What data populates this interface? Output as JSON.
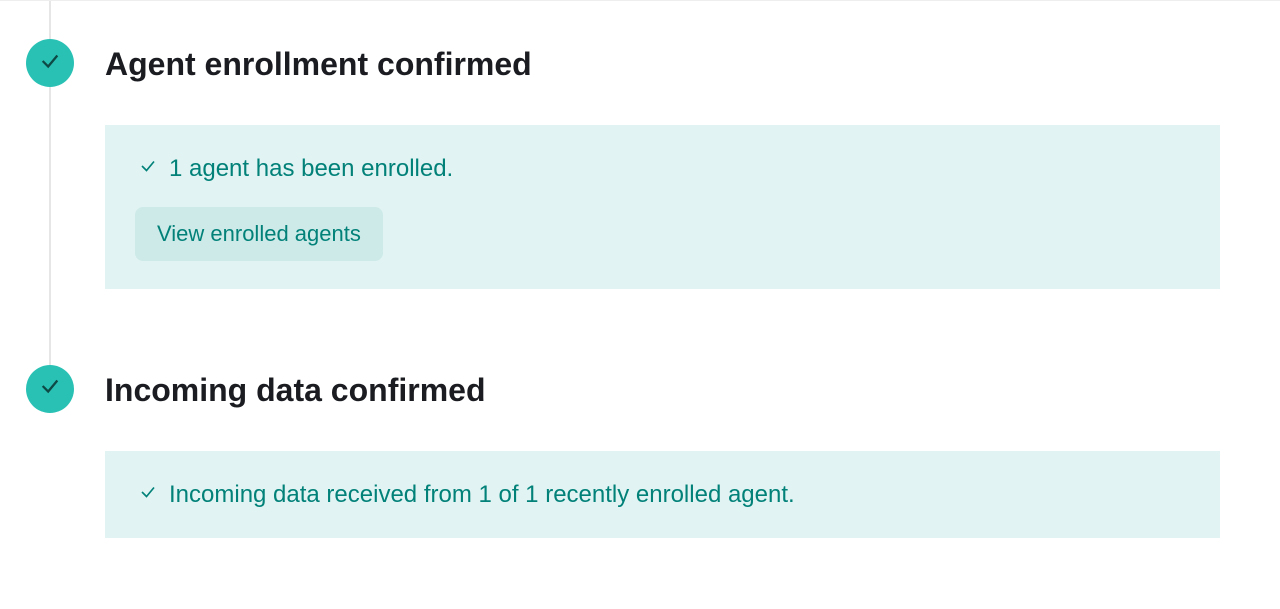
{
  "steps": [
    {
      "title": "Agent enrollment confirmed",
      "callout": {
        "message": "1 agent has been enrolled.",
        "button_label": "View enrolled agents"
      }
    },
    {
      "title": "Incoming data confirmed",
      "callout": {
        "message": "Incoming data received from 1 of 1 recently enrolled agent."
      }
    }
  ],
  "colors": {
    "accent": "#2ac1b5",
    "accent_text": "#028179",
    "callout_bg": "#e1f4f3",
    "button_bg": "#cdeae8"
  }
}
